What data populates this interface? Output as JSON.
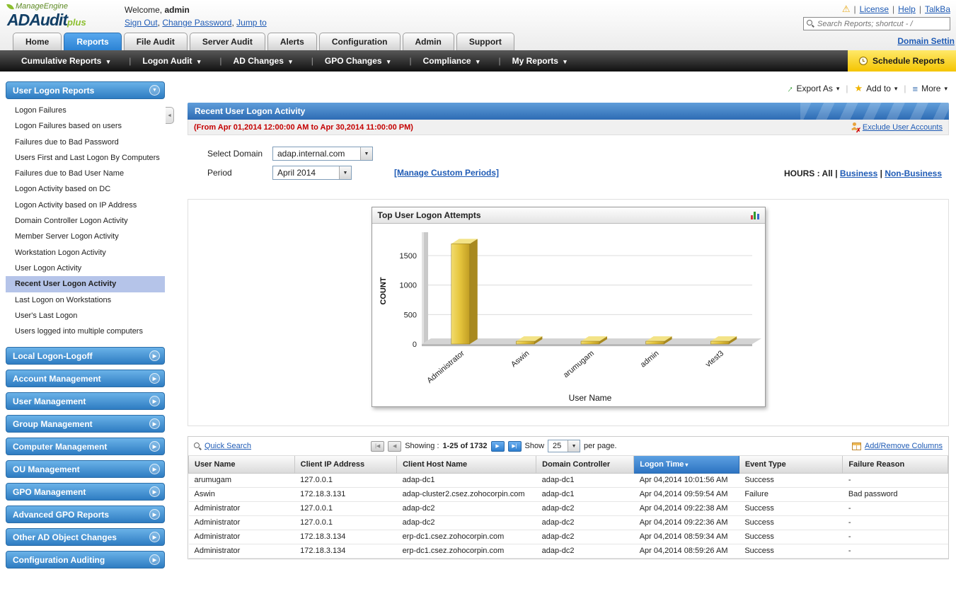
{
  "header": {
    "brand": "ManageEngine",
    "product": "ADAudit",
    "product_suffix": "plus",
    "welcome_label": "Welcome,",
    "welcome_user": "admin",
    "session_links": {
      "sign_out": "Sign Out",
      "change_password": "Change Password",
      "jump_to": "Jump to"
    },
    "utility_links": {
      "license": "License",
      "help": "Help",
      "talkback": "TalkBa"
    },
    "search_placeholder": "Search Reports; shortcut - /"
  },
  "tabs": [
    {
      "label": "Home",
      "active": false
    },
    {
      "label": "Reports",
      "active": true
    },
    {
      "label": "File Audit",
      "active": false
    },
    {
      "label": "Server Audit",
      "active": false
    },
    {
      "label": "Alerts",
      "active": false
    },
    {
      "label": "Configuration",
      "active": false
    },
    {
      "label": "Admin",
      "active": false
    },
    {
      "label": "Support",
      "active": false
    }
  ],
  "domain_settings_link": "Domain Settin",
  "menu": {
    "items": [
      "Cumulative Reports",
      "Logon Audit",
      "AD Changes",
      "GPO Changes",
      "Compliance",
      "My Reports"
    ],
    "schedule_button": "Schedule Reports"
  },
  "sidebar": {
    "active_section": "User Logon Reports",
    "items": [
      "Logon Failures",
      "Logon Failures based on users",
      "Failures due to Bad Password",
      "Users First and Last Logon By Computers",
      "Failures due to Bad User Name",
      "Logon Activity based on DC",
      "Logon Activity based on IP Address",
      "Domain Controller Logon Activity",
      "Member Server Logon Activity",
      "Workstation Logon Activity",
      "User Logon Activity",
      "Recent User Logon Activity",
      "Last Logon on Workstations",
      "User's Last Logon",
      "Users logged into multiple computers"
    ],
    "selected_item": "Recent User Logon Activity",
    "sections": [
      "Local Logon-Logoff",
      "Account Management",
      "User Management",
      "Group Management",
      "Computer Management",
      "OU Management",
      "GPO Management",
      "Advanced GPO Reports",
      "Other AD Object Changes",
      "Configuration Auditing"
    ]
  },
  "toolbar": {
    "export_label": "Export As",
    "add_label": "Add to",
    "more_label": "More"
  },
  "report": {
    "title": "Recent User Logon Activity",
    "date_range": "(From Apr 01,2014 12:00:00 AM to Apr 30,2014 11:00:00 PM)",
    "exclude_link": "Exclude User Accounts",
    "select_domain_label": "Select Domain",
    "domain_value": "adap.internal.com",
    "period_label": "Period",
    "period_value": "April 2014",
    "manage_periods_link": "[Manage Custom Periods]",
    "hours_label": "HOURS : All",
    "hours_business": "Business",
    "hours_nonbusiness": "Non-Business"
  },
  "chart_data": {
    "type": "bar",
    "title": "Top User Logon Attempts",
    "categories": [
      "Administrator",
      "Aswin",
      "arumugam",
      "admin",
      "vtest3"
    ],
    "values": [
      1700,
      30,
      30,
      30,
      30
    ],
    "xlabel": "User Name",
    "ylabel": "COUNT",
    "ylim": [
      0,
      1800
    ],
    "yticks": [
      0,
      500,
      1000,
      1500
    ],
    "grid": true,
    "legend": false,
    "bar_color": "#e6c63e"
  },
  "pager": {
    "quick_search": "Quick Search",
    "showing_label": "Showing :",
    "showing_range": "1-25 of 1732",
    "show_label": "Show",
    "page_size": "25",
    "per_page_label": "per page.",
    "add_remove_columns": "Add/Remove Columns"
  },
  "table": {
    "columns": [
      "User Name",
      "Client IP Address",
      "Client Host Name",
      "Domain Controller",
      "Logon Time",
      "Event Type",
      "Failure Reason"
    ],
    "sort_column": "Logon Time",
    "rows": [
      [
        "arumugam",
        "127.0.0.1",
        "adap-dc1",
        "adap-dc1",
        "Apr 04,2014 10:01:56 AM",
        "Success",
        "-"
      ],
      [
        "Aswin",
        "172.18.3.131",
        "adap-cluster2.csez.zohocorpin.com",
        "adap-dc1",
        "Apr 04,2014 09:59:54 AM",
        "Failure",
        "Bad password"
      ],
      [
        "Administrator",
        "127.0.0.1",
        "adap-dc2",
        "adap-dc2",
        "Apr 04,2014 09:22:38 AM",
        "Success",
        "-"
      ],
      [
        "Administrator",
        "127.0.0.1",
        "adap-dc2",
        "adap-dc2",
        "Apr 04,2014 09:22:36 AM",
        "Success",
        "-"
      ],
      [
        "Administrator",
        "172.18.3.134",
        "erp-dc1.csez.zohocorpin.com",
        "adap-dc2",
        "Apr 04,2014 08:59:34 AM",
        "Success",
        "-"
      ],
      [
        "Administrator",
        "172.18.3.134",
        "erp-dc1.csez.zohocorpin.com",
        "adap-dc2",
        "Apr 04,2014 08:59:26 AM",
        "Success",
        "-"
      ]
    ]
  },
  "icons": {
    "warning": "⚠",
    "caret_down": "▾",
    "arrow_down": "▼",
    "arrow_right": "▶",
    "arrow_left": "◄",
    "export_arrow": "↑",
    "star": "★",
    "more": "≡",
    "page_first": "|◀",
    "page_prev": "◀",
    "page_next": "▶",
    "page_last": "▶|"
  },
  "sep": {
    "comma": ",",
    "pipe": "|"
  },
  "colors": {
    "active_tab_blue": "#2c83d4",
    "sidebar_header_blue": "#2e7cc2",
    "selected_item_bg": "#b5c4e9",
    "schedule_button_yellow": "#f4c400",
    "date_range_red": "#c40000",
    "bar_gold": "#e6c63e",
    "sorted_column_blue": "#2e74c2",
    "link_blue": "#1f5bb5"
  }
}
